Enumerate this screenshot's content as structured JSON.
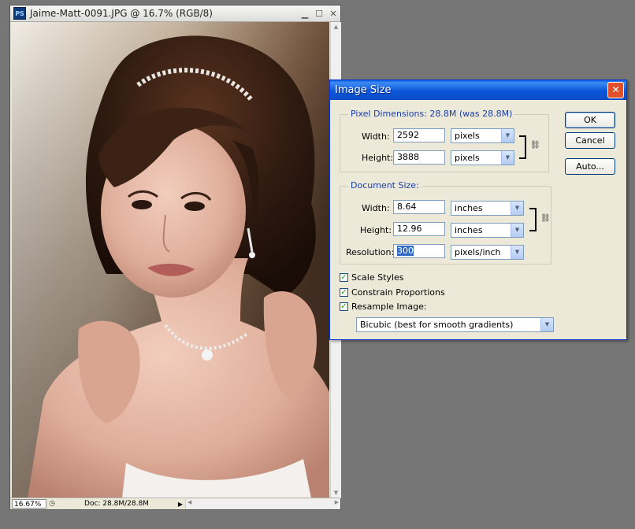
{
  "document_window": {
    "app_icon": "PS",
    "title": "Jaime-Matt-0091.JPG @ 16.7% (RGB/8)",
    "minimize_glyph": "▁",
    "maximize_glyph": "☐",
    "close_glyph": "✕",
    "status": {
      "zoom": "16.67%",
      "doc_info": "Doc: 28.8M/28.8M"
    }
  },
  "dialog": {
    "title": "Image Size",
    "pixel_dimensions": {
      "label": "Pixel Dimensions:",
      "size_text": "28.8M (was 28.8M)",
      "width_label": "Width:",
      "width_value": "2592",
      "width_unit": "pixels",
      "height_label": "Height:",
      "height_value": "3888",
      "height_unit": "pixels"
    },
    "document_size": {
      "label": "Document Size:",
      "width_label": "Width:",
      "width_value": "8.64",
      "width_unit": "inches",
      "height_label": "Height:",
      "height_value": "12.96",
      "height_unit": "inches",
      "resolution_label": "Resolution:",
      "resolution_value": "300",
      "resolution_unit": "pixels/inch"
    },
    "options": {
      "scale_styles": "Scale Styles",
      "constrain_proportions": "Constrain Proportions",
      "resample_image": "Resample Image:",
      "resample_method": "Bicubic (best for smooth gradients)"
    },
    "buttons": {
      "ok": "OK",
      "cancel": "Cancel",
      "auto": "Auto..."
    }
  },
  "colors": {
    "desktop": "#767676",
    "dialog_title": "#0a5fe0",
    "group_title": "#1a3da8",
    "selection": "#316ac5"
  }
}
